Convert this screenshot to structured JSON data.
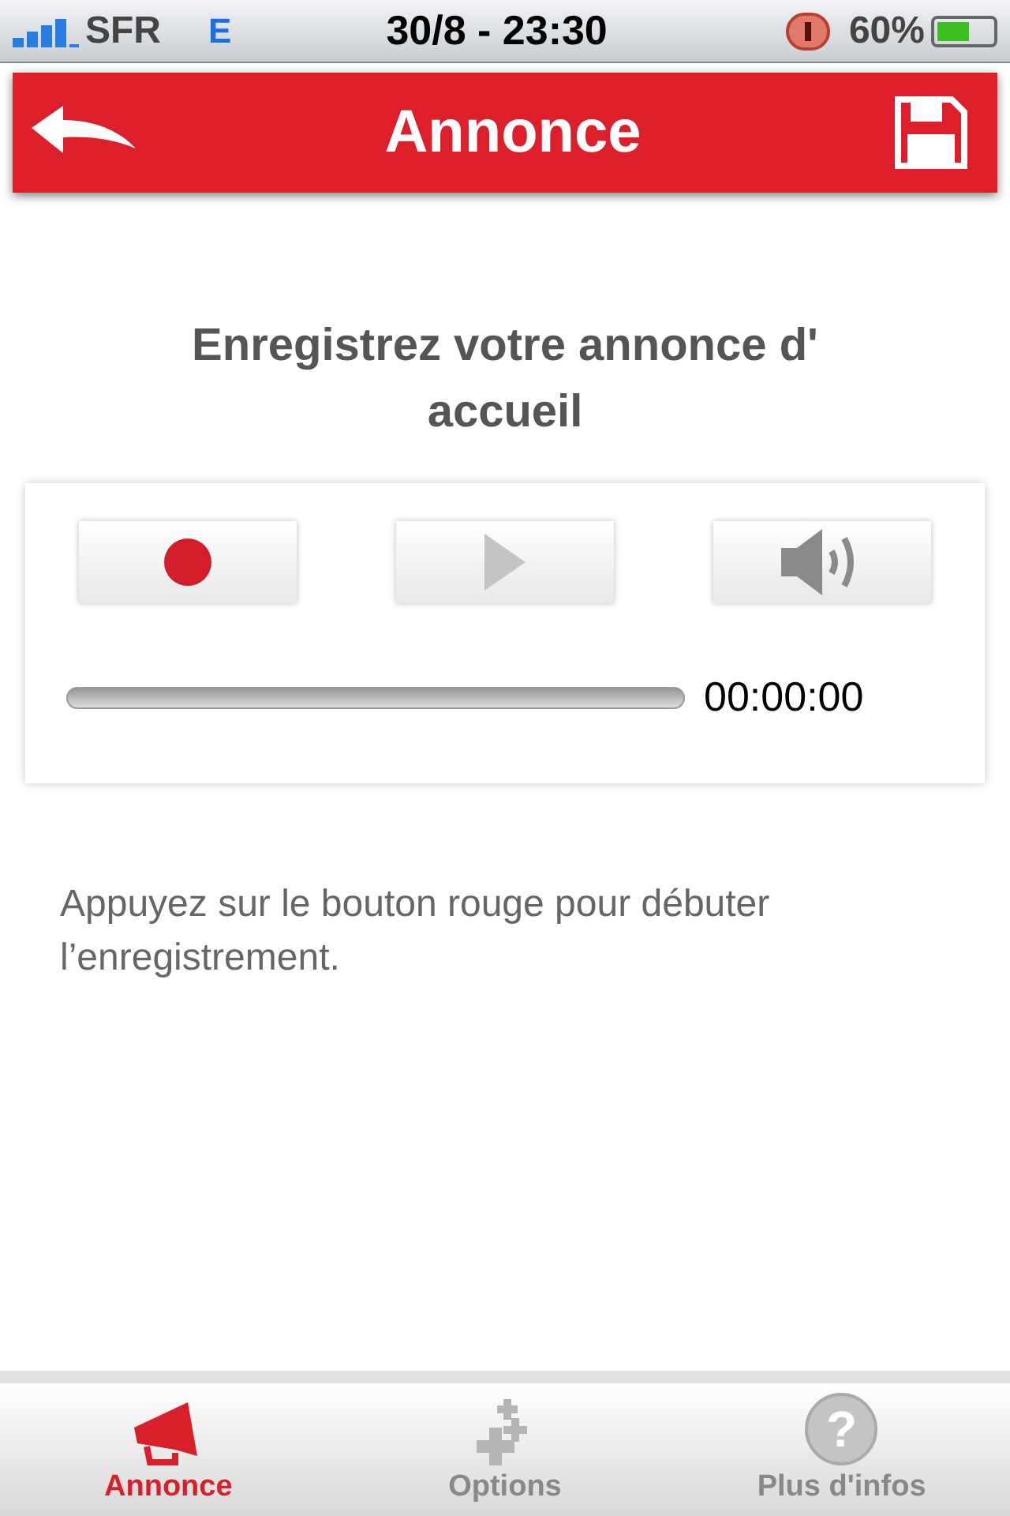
{
  "status_bar": {
    "carrier": "SFR",
    "network": "E",
    "time": "30/8 - 23:30",
    "battery": "60%"
  },
  "header": {
    "title": "Annonce"
  },
  "heading": "Enregistrez votre annonce d' accueil",
  "player": {
    "progress": {
      "level": 0
    },
    "elapsed": "00:00:00"
  },
  "hint": "Appuyez sur le bouton rouge pour débuter l’enregistrement.",
  "tabs": [
    {
      "label": "Annonce",
      "kind": "megaphone",
      "selected": true
    },
    {
      "label": "Options",
      "kind": "plus",
      "selected": false
    },
    {
      "label": "Plus d'infos",
      "kind": "help",
      "glyph": "?",
      "selected": false
    }
  ]
}
